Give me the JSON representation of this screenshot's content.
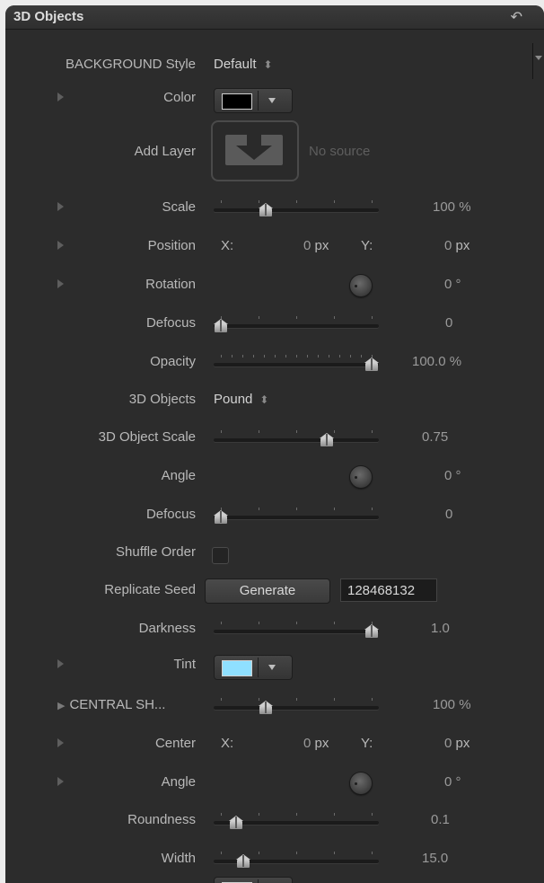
{
  "window": {
    "title": "3D Objects",
    "reset_icon": "reset-arrow-icon"
  },
  "rows": {
    "background_style": {
      "label": "BACKGROUND Style",
      "value": "Default"
    },
    "color": {
      "label": "Color",
      "swatch": "#000000"
    },
    "add_layer": {
      "label": "Add Layer",
      "status": "No source"
    },
    "scale": {
      "label": "Scale",
      "value": "100",
      "unit": "%",
      "level": 0.3
    },
    "position": {
      "label": "Position",
      "x_label": "X:",
      "x_value": "0",
      "x_unit": "px",
      "y_label": "Y:",
      "y_value": "0",
      "y_unit": "px"
    },
    "rotation": {
      "label": "Rotation",
      "value": "0",
      "unit": "°"
    },
    "defocus": {
      "label": "Defocus",
      "value": "0",
      "level": 0
    },
    "opacity": {
      "label": "Opacity",
      "value": "100.0",
      "unit": "%",
      "level": 1
    },
    "objects_3d": {
      "label": "3D Objects",
      "value": "Pound"
    },
    "object_scale": {
      "label": "3D Object Scale",
      "value": "0.75",
      "level": 0.7
    },
    "angle": {
      "label": "Angle",
      "value": "0",
      "unit": "°"
    },
    "defocus2": {
      "label": "Defocus",
      "value": "0",
      "level": 0
    },
    "shuffle": {
      "label": "Shuffle Order"
    },
    "replicate_seed": {
      "label": "Replicate Seed",
      "button": "Generate",
      "value": "128468132"
    },
    "darkness": {
      "label": "Darkness",
      "value": "1.0",
      "level": 1
    },
    "tint": {
      "label": "Tint",
      "swatch": "#8fe0ff"
    },
    "central_sh": {
      "label": "CENTRAL SH...",
      "value": "100",
      "unit": "%",
      "level": 0.3
    },
    "center": {
      "label": "Center",
      "x_label": "X:",
      "x_value": "0",
      "x_unit": "px",
      "y_label": "Y:",
      "y_value": "0",
      "y_unit": "px"
    },
    "angle2": {
      "label": "Angle",
      "value": "0",
      "unit": "°"
    },
    "roundness": {
      "label": "Roundness",
      "value": "0.1",
      "level": 0.1
    },
    "width": {
      "label": "Width",
      "value": "15.0",
      "level": 0.15
    }
  },
  "colors": {
    "panel": "#2c2c2c",
    "text": "#b9b9b9",
    "value": "#9a9a9a",
    "tint": "#8fe0ff"
  }
}
